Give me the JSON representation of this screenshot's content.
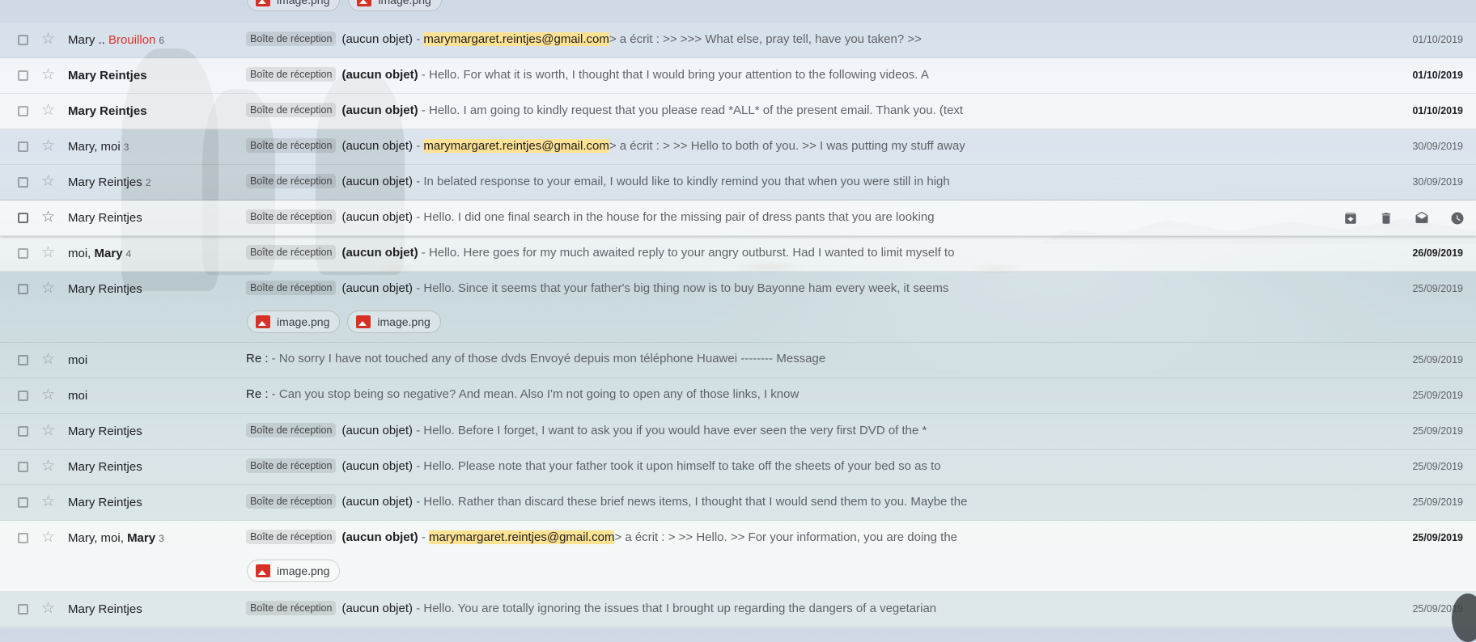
{
  "label_text": "Boîte de réception",
  "attachment_name": "image.png",
  "top_attachments": [
    "image.png",
    "image.png"
  ],
  "emails": [
    {
      "sender_parts": [
        {
          "t": "Mary .."
        },
        {
          "t": " Brouillon",
          "draft": true
        }
      ],
      "count": "6",
      "label": true,
      "subject": "(aucun objet)",
      "sep": " - ",
      "highlight": "marymargaret.reintjes@gmail.com",
      "snippet": "> a écrit : >> >>> What else, pray tell, have you taken? >>",
      "date": "01/10/2019",
      "unread": false
    },
    {
      "sender_parts": [
        {
          "t": "Mary Reintjes"
        }
      ],
      "count": "",
      "label": true,
      "subject": "(aucun objet)",
      "sep": " - ",
      "highlight": "",
      "snippet": "Hello. For what it is worth, I thought that I would bring your attention to the following videos. A",
      "date": "01/10/2019",
      "unread": true
    },
    {
      "sender_parts": [
        {
          "t": "Mary Reintjes"
        }
      ],
      "count": "",
      "label": true,
      "subject": "(aucun objet)",
      "sep": " - ",
      "highlight": "",
      "snippet": "Hello. I am going to kindly request that you please read *ALL* of the present email. Thank you. (text",
      "date": "01/10/2019",
      "unread": true
    },
    {
      "sender_parts": [
        {
          "t": "Mary, moi"
        }
      ],
      "count": "3",
      "label": true,
      "subject": "(aucun objet)",
      "sep": " - ",
      "highlight": "marymargaret.reintjes@gmail.com",
      "snippet": "> a écrit : > >> Hello to both of you. >> I was putting my stuff away",
      "date": "30/09/2019",
      "unread": false
    },
    {
      "sender_parts": [
        {
          "t": "Mary Reintjes"
        }
      ],
      "count": "2",
      "label": true,
      "subject": "(aucun objet)",
      "sep": " - ",
      "highlight": "",
      "snippet": "In belated response to your email, I would like to kindly remind you that when you were still in high",
      "date": "30/09/2019",
      "unread": false
    },
    {
      "sender_parts": [
        {
          "t": "Mary Reintjes"
        }
      ],
      "count": "",
      "label": true,
      "subject": "(aucun objet)",
      "sep": " - ",
      "highlight": "",
      "snippet": "Hello. I did one final search in the house for the missing pair of dress pants that you are looking",
      "date": "",
      "unread": false,
      "hover": true
    },
    {
      "sender_parts": [
        {
          "t": "moi, ",
          "nb": true
        },
        {
          "t": "Mary",
          "b": true
        }
      ],
      "count": "4",
      "label": true,
      "subject": "(aucun objet)",
      "sep": " - ",
      "highlight": "",
      "snippet": "Hello. Here goes for my much awaited reply to your angry outburst. Had I wanted to limit myself to",
      "date": "26/09/2019",
      "unread": true
    },
    {
      "sender_parts": [
        {
          "t": "Mary Reintjes"
        }
      ],
      "count": "",
      "label": true,
      "subject": "(aucun objet)",
      "sep": " - ",
      "highlight": "",
      "snippet": "Hello. Since it seems that your father's big thing now is to buy Bayonne ham every week, it seems",
      "date": "25/09/2019",
      "unread": false,
      "attachments": [
        "image.png",
        "image.png"
      ]
    },
    {
      "sender_parts": [
        {
          "t": "moi"
        }
      ],
      "count": "",
      "label": false,
      "subject": "Re :",
      "sep": " - ",
      "highlight": "",
      "snippet": "No sorry I have not touched any of those dvds Envoyé depuis mon téléphone Huawei -------- Message",
      "date": "25/09/2019",
      "unread": false
    },
    {
      "sender_parts": [
        {
          "t": "moi"
        }
      ],
      "count": "",
      "label": false,
      "subject": "Re :",
      "sep": " - ",
      "highlight": "",
      "snippet": "Can you stop being so negative? And mean. Also I'm not going to open any of those links, I know",
      "date": "25/09/2019",
      "unread": false
    },
    {
      "sender_parts": [
        {
          "t": "Mary Reintjes"
        }
      ],
      "count": "",
      "label": true,
      "subject": "(aucun objet)",
      "sep": " - ",
      "highlight": "",
      "snippet": "Hello. Before I forget, I want to ask you if you would have ever seen the very first DVD of the *",
      "date": "25/09/2019",
      "unread": false
    },
    {
      "sender_parts": [
        {
          "t": "Mary Reintjes"
        }
      ],
      "count": "",
      "label": true,
      "subject": "(aucun objet)",
      "sep": " - ",
      "highlight": "",
      "snippet": "Hello. Please note that your father took it upon himself to take off the sheets of your bed so as to",
      "date": "25/09/2019",
      "unread": false
    },
    {
      "sender_parts": [
        {
          "t": "Mary Reintjes"
        }
      ],
      "count": "",
      "label": true,
      "subject": "(aucun objet)",
      "sep": " - ",
      "highlight": "",
      "snippet": "Hello. Rather than discard these brief news items, I thought that I would send them to you. Maybe the",
      "date": "25/09/2019",
      "unread": false
    },
    {
      "sender_parts": [
        {
          "t": "Mary, moi, ",
          "nb": true
        },
        {
          "t": "Mary",
          "b": true
        }
      ],
      "count": "3",
      "label": true,
      "subject": "(aucun objet)",
      "sep": " - ",
      "highlight": "marymargaret.reintjes@gmail.com",
      "snippet": "> a écrit : > >> Hello. >> For your information, you are doing the",
      "date": "25/09/2019",
      "unread": true,
      "attachments": [
        "image.png"
      ]
    },
    {
      "sender_parts": [
        {
          "t": "Mary Reintjes"
        }
      ],
      "count": "",
      "label": true,
      "subject": "(aucun objet)",
      "sep": " - ",
      "highlight": "",
      "snippet": "Hello. You are totally ignoring the issues that I brought up regarding the dangers of a vegetarian",
      "date": "25/09/2019",
      "unread": false
    }
  ],
  "hover_actions": [
    "archive-icon",
    "delete-icon",
    "mark-read-icon",
    "snooze-icon"
  ]
}
